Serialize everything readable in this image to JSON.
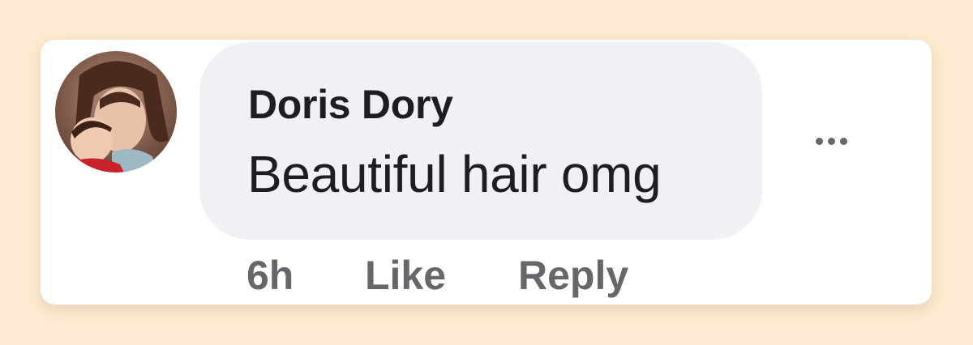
{
  "comment": {
    "author": "Doris Dory",
    "text": "Beautiful hair omg",
    "timestamp": "6h",
    "actions": {
      "like_label": "Like",
      "reply_label": "Reply"
    },
    "more_icon": "more-horizontal-icon",
    "avatar_icon": "profile-photo"
  },
  "colors": {
    "page_background": "#fdebd3",
    "card_background": "#ffffff",
    "bubble_background": "#f0f1f5",
    "primary_text": "#1c1e21",
    "secondary_text": "#65676b"
  }
}
